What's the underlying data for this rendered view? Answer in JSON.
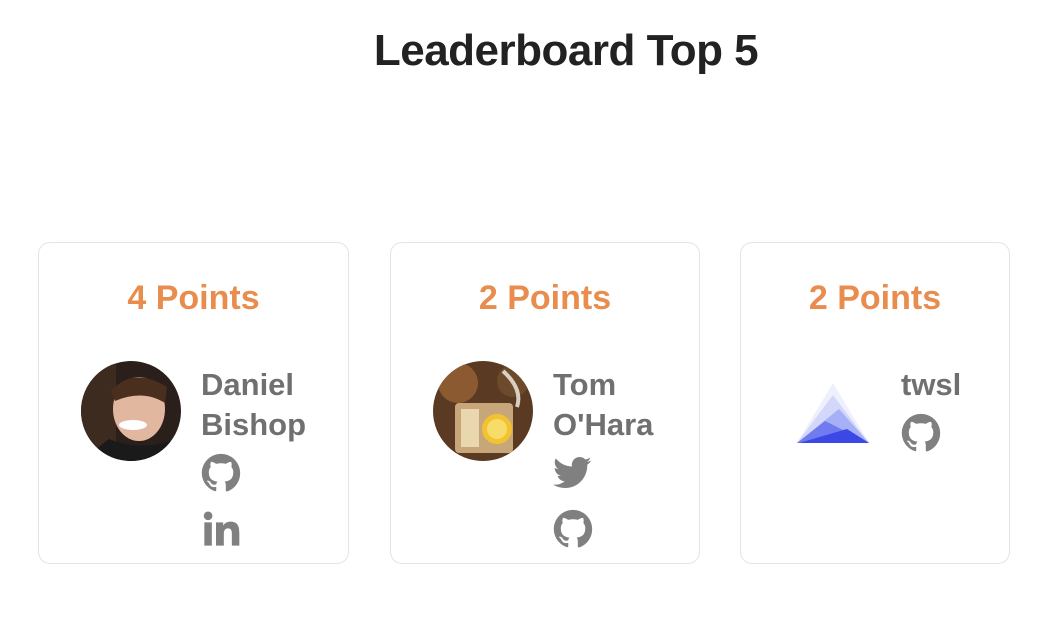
{
  "title": "Leaderboard Top 5",
  "colors": {
    "accent": "#e88d4e",
    "name_text": "#707070",
    "icon": "#808080",
    "border": "#e4e4e4"
  },
  "leaders": [
    {
      "points": "4 Points",
      "name": [
        "Daniel",
        "Bishop"
      ],
      "icons": [
        "github-icon",
        "linkedin-icon"
      ]
    },
    {
      "points": "2 Points",
      "name": [
        "Tom",
        "O'Hara"
      ],
      "icons": [
        "twitter-icon",
        "github-icon"
      ]
    },
    {
      "points": "2 Points",
      "name": [
        "twsl"
      ],
      "icons": [
        "github-icon"
      ]
    }
  ]
}
